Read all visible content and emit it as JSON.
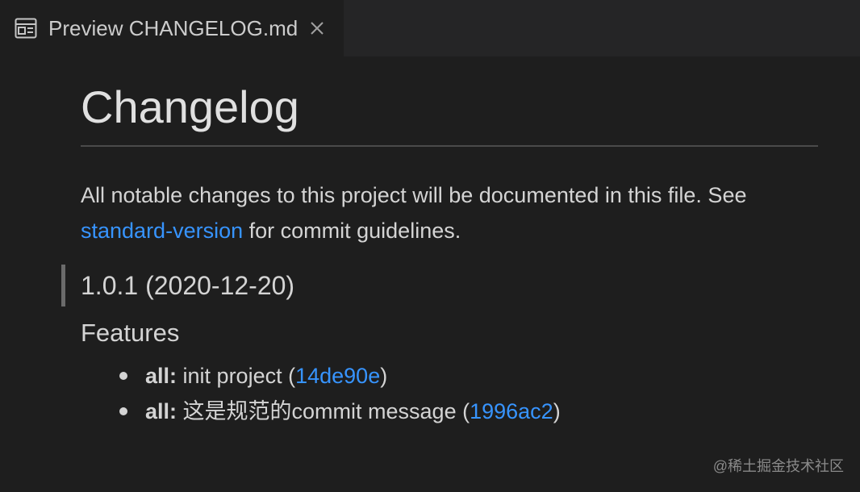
{
  "tab": {
    "title": "Preview CHANGELOG.md",
    "icon": "preview-icon",
    "close_icon": "close-icon"
  },
  "doc": {
    "h1": "Changelog",
    "intro_before_link": "All notable changes to this project will be documented in this file. See",
    "intro_link": "standard-version",
    "intro_after_link": "for commit guidelines.",
    "version_heading": "1.0.1 (2020-12-20)",
    "features_heading": "Features",
    "items": [
      {
        "scope": "all:",
        "text": "init project (",
        "hash": "14de90e",
        "close": ")"
      },
      {
        "scope": "all:",
        "text": "这是规范的commit message (",
        "hash": "1996ac2",
        "close": ")"
      }
    ]
  },
  "watermark": "@稀土掘金技术社区",
  "colors": {
    "background": "#1e1e1e",
    "tabbar": "#252526",
    "link": "#3794ff",
    "text": "#d4d4d4"
  }
}
